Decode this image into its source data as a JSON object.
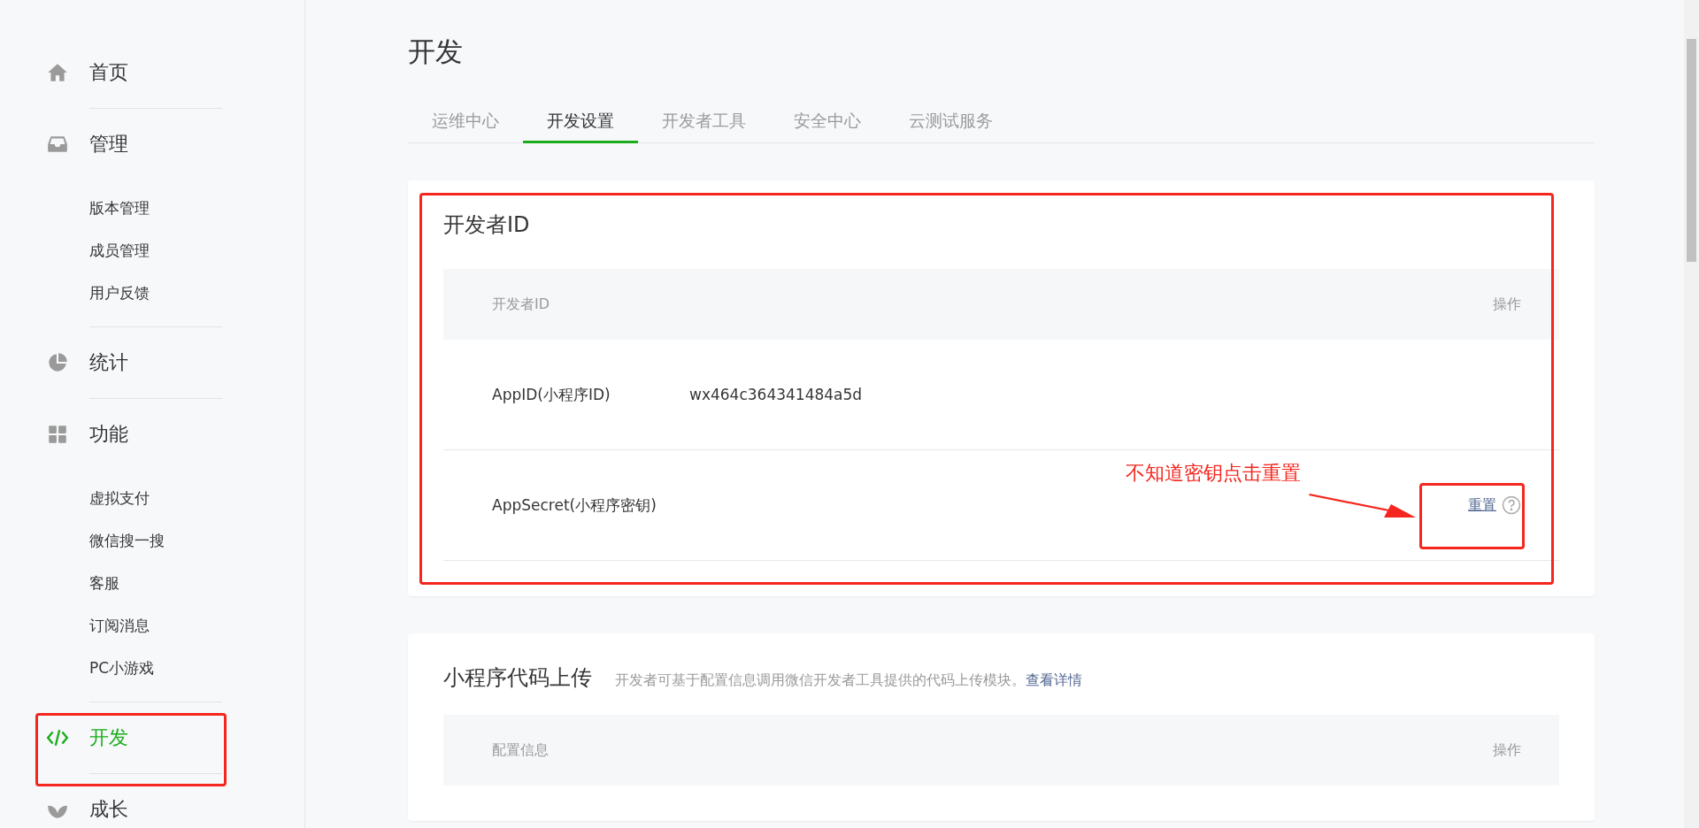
{
  "sidebar": {
    "sections": [
      {
        "label": "首页",
        "selected": false
      },
      {
        "label": "管理",
        "selected": false,
        "children": [
          {
            "label": "版本管理"
          },
          {
            "label": "成员管理"
          },
          {
            "label": "用户反馈"
          }
        ]
      },
      {
        "label": "统计",
        "selected": false
      },
      {
        "label": "功能",
        "selected": false,
        "children": [
          {
            "label": "虚拟支付"
          },
          {
            "label": "微信搜一搜"
          },
          {
            "label": "客服"
          },
          {
            "label": "订阅消息"
          },
          {
            "label": "PC小游戏"
          }
        ]
      },
      {
        "label": "开发",
        "selected": true
      },
      {
        "label": "成长",
        "selected": false
      }
    ]
  },
  "page_title": "开发",
  "tabs": [
    {
      "label": "运维中心",
      "selected": false
    },
    {
      "label": "开发设置",
      "selected": true
    },
    {
      "label": "开发者工具",
      "selected": false
    },
    {
      "label": "安全中心",
      "selected": false
    },
    {
      "label": "云测试服务",
      "selected": false
    }
  ],
  "developer_id_card": {
    "title": "开发者ID",
    "columns": [
      "开发者ID",
      "操作"
    ],
    "rows": [
      {
        "kind": "value",
        "label": "AppID(小程序ID)",
        "value": "wx464c364341484a5d"
      },
      {
        "kind": "action",
        "label": "AppSecret(小程序密钥)",
        "action": "重置"
      }
    ]
  },
  "upload_card": {
    "title": "小程序代码上传",
    "description": "开发者可基于配置信息调用微信开发者工具提供的代码上传模块。",
    "link": "查看详情",
    "columns": [
      "配置信息",
      "操作"
    ]
  },
  "annotation": {
    "text": "不知道密钥点击重置"
  }
}
